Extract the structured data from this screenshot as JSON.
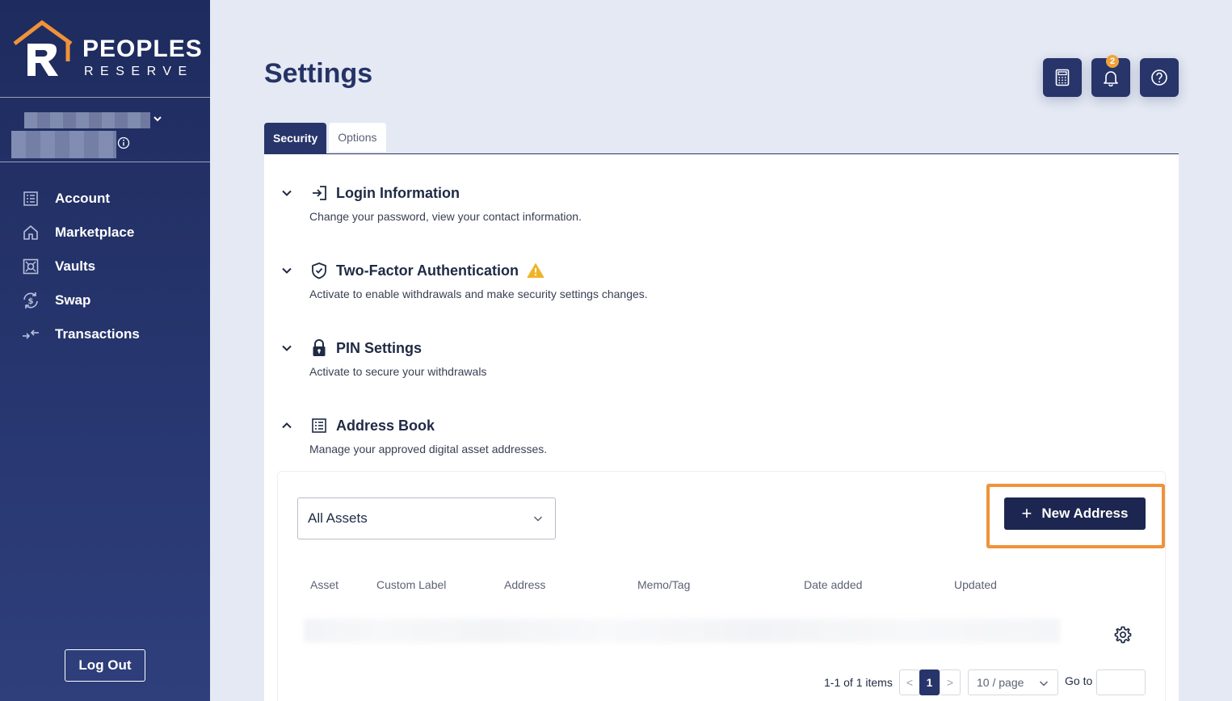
{
  "brand": {
    "line1": "PEOPLES",
    "line2": "RESERVE",
    "accent": "#f0923a"
  },
  "sidebar": {
    "items": [
      {
        "label": "Account",
        "icon": "ledger-icon"
      },
      {
        "label": "Marketplace",
        "icon": "home-icon"
      },
      {
        "label": "Vaults",
        "icon": "vault-icon"
      },
      {
        "label": "Swap",
        "icon": "swap-dollar-icon"
      },
      {
        "label": "Transactions",
        "icon": "transfer-arrows-icon"
      }
    ],
    "logout_label": "Log Out"
  },
  "header": {
    "title": "Settings",
    "notification_count": "2"
  },
  "tabs": [
    {
      "label": "Security",
      "active": true
    },
    {
      "label": "Options",
      "active": false
    }
  ],
  "sections": [
    {
      "title": "Login Information",
      "description": "Change your password, view your contact information.",
      "expanded": false
    },
    {
      "title": "Two-Factor Authentication",
      "description": "Activate to enable withdrawals and make security settings changes.",
      "expanded": false,
      "warning": true
    },
    {
      "title": "PIN Settings",
      "description": "Activate to secure your withdrawals",
      "expanded": false
    },
    {
      "title": "Address Book",
      "description": "Manage your approved digital asset addresses.",
      "expanded": true
    }
  ],
  "address_book": {
    "filter_value": "All Assets",
    "new_button_label": "New Address",
    "columns": [
      "Asset",
      "Custom Label",
      "Address",
      "Memo/Tag",
      "Date added",
      "Updated"
    ],
    "pagination": {
      "summary": "1-1 of 1 items",
      "prev": "<",
      "current_page": "1",
      "next": ">",
      "page_size": "10 / page",
      "goto_label": "Go to"
    }
  },
  "colors": {
    "navy": "#27356a",
    "button_dark": "#1c2650",
    "warning": "#f0b429",
    "highlight": "#f0923a"
  }
}
